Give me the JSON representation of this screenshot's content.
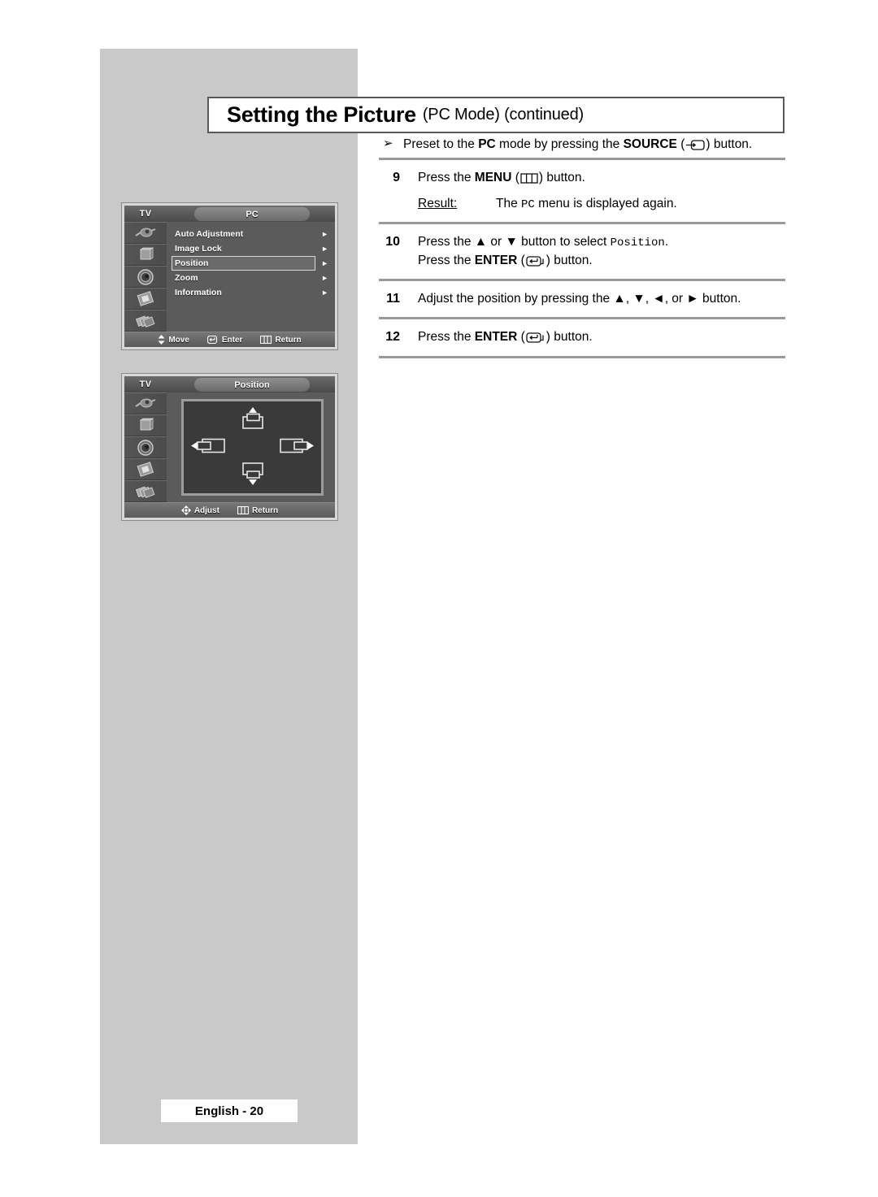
{
  "page": {
    "title_main": "Setting the Picture",
    "title_sub": "(PC Mode) (continued)",
    "footer": "English - 20"
  },
  "preset_note": {
    "bullet": "➢",
    "text_1": "Preset to the ",
    "bold_1": "PC",
    "text_2": " mode by pressing the ",
    "bold_2": "SOURCE",
    "icon": "source-icon",
    "text_3": " button."
  },
  "steps": [
    {
      "num": "9",
      "text_1": "Press the ",
      "bold_1": "MENU",
      "icon": "menu-icon",
      "text_2": " button.",
      "result_label": "Result:",
      "result_1": "The ",
      "result_mono": "PC",
      "result_2": " menu is displayed again."
    },
    {
      "num": "10",
      "line1_1": "Press the ",
      "line1_up": "▲",
      "line1_2": " or ",
      "line1_down": "▼",
      "line1_3": " button to select ",
      "line1_mono": "Position",
      "line1_4": ".",
      "line2_1": "Press the ",
      "line2_bold": "ENTER",
      "icon": "enter-icon",
      "line2_2": " button."
    },
    {
      "num": "11",
      "text_1": "Adjust the position by pressing the ",
      "up": "▲",
      "sep1": ", ",
      "down": "▼",
      "sep2": ", ",
      "left": "◄",
      "sep3": ", or ",
      "right": "►",
      "text_2": " button."
    },
    {
      "num": "12",
      "text_1": "Press the ",
      "bold_1": "ENTER",
      "icon": "enter-icon",
      "text_2": " button."
    }
  ],
  "osd_menu": {
    "tv_label": "TV",
    "tab_label": "PC",
    "items": [
      {
        "label": "Auto Adjustment",
        "arrow": "►",
        "selected": false
      },
      {
        "label": "Image Lock",
        "arrow": "►",
        "selected": false
      },
      {
        "label": "Position",
        "arrow": "►",
        "selected": true
      },
      {
        "label": "Zoom",
        "arrow": "►",
        "selected": false
      },
      {
        "label": "Information",
        "arrow": "►",
        "selected": false
      }
    ],
    "hints": [
      {
        "icon": "updown-icon",
        "label": "Move"
      },
      {
        "icon": "enter-icon",
        "label": "Enter"
      },
      {
        "icon": "menu-icon",
        "label": "Return"
      }
    ],
    "side_icons": [
      "input-icon",
      "picture-icon",
      "sound-icon",
      "setup-icon",
      "channel-icon"
    ]
  },
  "osd_position": {
    "tv_label": "TV",
    "tab_label": "Position",
    "hints": [
      {
        "icon": "fourway-icon",
        "label": "Adjust"
      },
      {
        "icon": "menu-icon",
        "label": "Return"
      }
    ],
    "side_icons": [
      "input-icon",
      "picture-icon",
      "sound-icon",
      "setup-icon",
      "channel-icon"
    ],
    "adjust_icons": [
      "shift-up-icon",
      "shift-left-icon",
      "shift-right-icon",
      "shift-down-icon"
    ]
  },
  "colors": {
    "page_gray": "#c9c9c9",
    "osd_body": "#5b5b5b",
    "rule": "#9a9a9a"
  }
}
